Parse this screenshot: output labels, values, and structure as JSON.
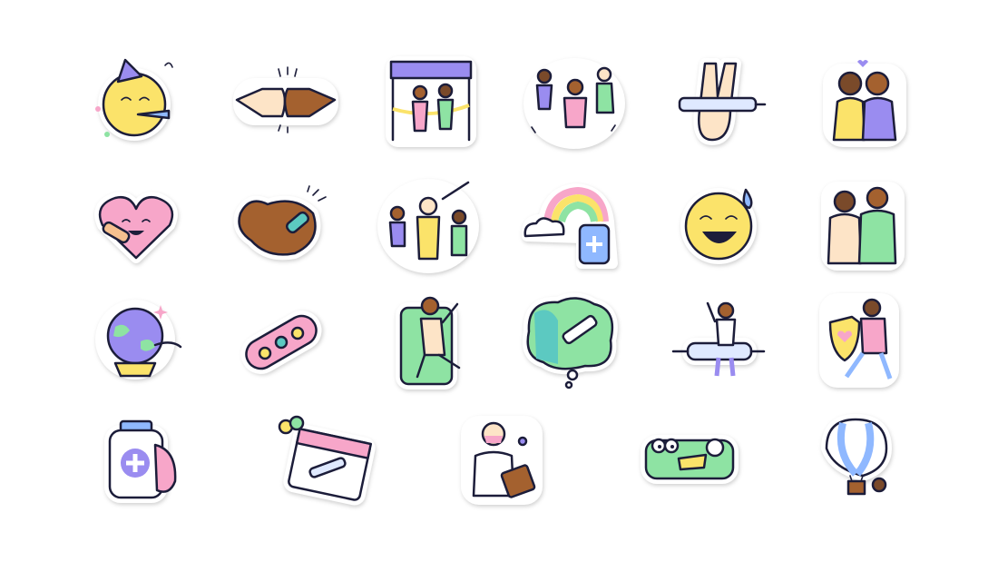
{
  "sheet": {
    "background": "#ffffff",
    "outline_color": "#1c1d3a",
    "rows": [
      [
        "party-face-sticker",
        "fist-bump-sticker",
        "finish-line-sticker",
        "dancing-people-sticker",
        "peace-sign-syringe-sticker",
        "hugging-couple-sticker"
      ],
      [
        "happy-heart-bandage-sticker",
        "flexed-arm-bandage-sticker",
        "celebrating-crowd-sticker",
        "rainbow-cloud-vaccine-sticker",
        "relieved-sweat-face-sticker",
        "friends-embrace-sticker"
      ],
      [
        "globe-in-hand-sticker",
        "smiley-bandage-sticker",
        "phone-high-five-sticker",
        "thought-bubble-vaccine-sticker",
        "riding-syringe-sticker",
        "heart-shield-sticker"
      ],
      [
        "vaccine-vial-hug-sticker",
        "calendar-balloons-sticker",
        "doctor-clipboard-sticker",
        "bandage-creature-sticker",
        "hot-air-balloon-sticker"
      ]
    ]
  },
  "colors": {
    "yellow": "#fbe36a",
    "pink": "#f7a6c9",
    "brown": "#a4612f",
    "purple": "#9a8cf0",
    "teal": "#5cc9c1",
    "green": "#8ee3a3",
    "blue": "#8fb8ff",
    "skin": "#fde4c7",
    "dark_skin": "#7a4a2a"
  }
}
